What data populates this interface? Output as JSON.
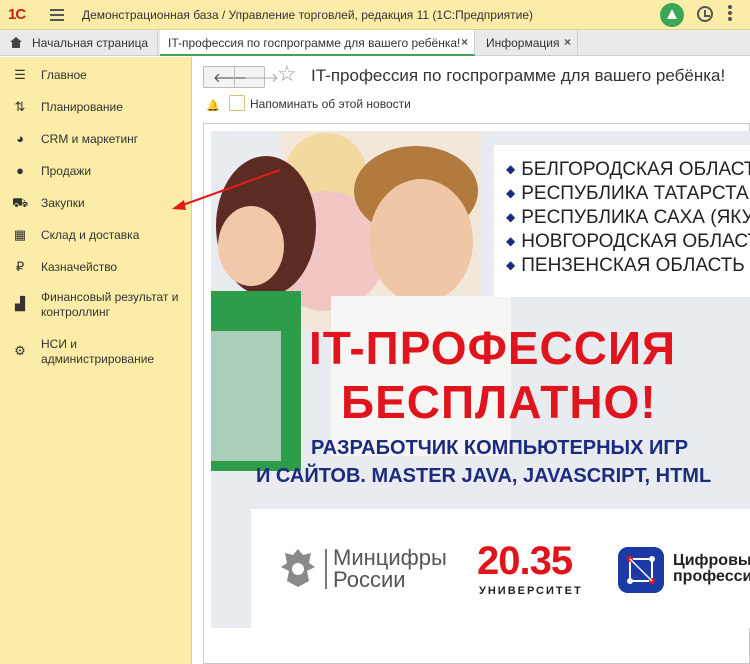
{
  "app": {
    "logo": "1С",
    "title": "Демонстрационная база / Управление торговлей, редакция 11  (1С:Предприятие)"
  },
  "tabs": [
    {
      "label": "Начальная страница"
    },
    {
      "label": "IT-профессия по госпрограмме для вашего ребёнка!",
      "close": "×"
    },
    {
      "label": "Информация",
      "close": "×"
    }
  ],
  "sidebar": {
    "items": [
      {
        "label": "Главное",
        "icon": "list-icon"
      },
      {
        "label": "Планирование",
        "icon": "planning-icon"
      },
      {
        "label": "CRM и маркетинг",
        "icon": "pie-chart-icon"
      },
      {
        "label": "Продажи",
        "icon": "bag-icon"
      },
      {
        "label": "Закупки",
        "icon": "cart-icon"
      },
      {
        "label": "Склад и доставка",
        "icon": "warehouse-icon"
      },
      {
        "label": "Казначейство",
        "icon": "ruble-icon"
      },
      {
        "label": "Финансовый результат и контроллинг",
        "icon": "bar-chart-icon"
      },
      {
        "label": "НСИ и администрирование",
        "icon": "gear-icon"
      }
    ]
  },
  "content": {
    "title": "IT-профессия по госпрограмме для вашего ребёнка!",
    "remind_label": "Напоминать об этой новости",
    "remind_checked": false
  },
  "banner": {
    "regions": [
      "БЕЛГОРОДСКАЯ ОБЛАСТЬ",
      "РЕСПУБЛИКА ТАТАРСТАН",
      "РЕСПУБЛИКА САХА (ЯКУТИЯ)",
      "НОВГОРОДСКАЯ ОБЛАСТЬ",
      "ПЕНЗЕНСКАЯ ОБЛАСТЬ"
    ],
    "headline_1": "IT-ПРОФЕССИЯ",
    "headline_2": "БЕСПЛАТНО!",
    "sub_1": "РАЗРАБОТЧИК КОМПЬЮТЕРНЫХ ИГР",
    "sub_2": "И САЙТОВ. MASTER JAVA, JAVASCRIPT, HTML",
    "mincifry_1": "Минцифры",
    "mincifry_2": "России",
    "univ_number": "20.35",
    "univ_label": "УНИВЕРСИТЕТ",
    "cifr_1": "Цифровые",
    "cifr_2": "профессии"
  },
  "colors": {
    "sidebar_bg": "#fbeda8",
    "accent_green": "#3aa656",
    "brand_red": "#e0141d",
    "banner_blue": "#1d2b7e"
  }
}
